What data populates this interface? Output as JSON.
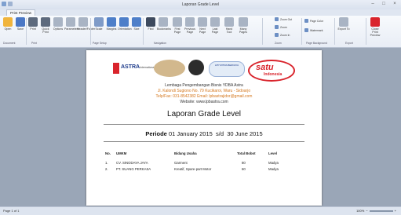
{
  "window": {
    "title": "Laporan Grade Level"
  },
  "tabs": [
    "Print Preview"
  ],
  "ribbon": {
    "buttons": [
      {
        "label": "Open",
        "icon": "open-folder-icon",
        "color": "#f0b43c"
      },
      {
        "label": "Save",
        "icon": "save-disk-icon",
        "color": "#4a77c5"
      },
      {
        "label": "Print",
        "icon": "printer-icon",
        "color": "#5d6a7d"
      },
      {
        "label": "Quick Print",
        "icon": "quick-print-icon",
        "color": "#5d6a7d"
      },
      {
        "label": "Options",
        "icon": "options-icon",
        "color": "#a9b4c4"
      },
      {
        "label": "Parameters",
        "icon": "parameters-icon",
        "color": "#a9b4c4"
      },
      {
        "label": "Header/Footer",
        "icon": "header-footer-icon",
        "color": "#a9b4c4"
      },
      {
        "label": "Scale",
        "icon": "scale-icon",
        "color": "#7f9bc8"
      },
      {
        "label": "Margins",
        "icon": "margins-icon",
        "color": "#4e7fc9"
      },
      {
        "label": "Orientation",
        "icon": "orientation-icon",
        "color": "#4e7fc9"
      },
      {
        "label": "Size",
        "icon": "page-size-icon",
        "color": "#4e7fc9"
      },
      {
        "label": "Find",
        "icon": "find-binoculars-icon",
        "color": "#3d4a5e"
      },
      {
        "label": "Bookmarks",
        "icon": "bookmarks-icon",
        "color": "#a9b4c4"
      },
      {
        "label": "First Page",
        "icon": "first-page-icon",
        "color": "#a9b4c4"
      },
      {
        "label": "Previous Page",
        "icon": "previous-page-icon",
        "color": "#a9b4c4"
      },
      {
        "label": "Next Page",
        "icon": "next-page-icon",
        "color": "#a9b4c4"
      },
      {
        "label": "Last Page",
        "icon": "last-page-icon",
        "color": "#a9b4c4"
      },
      {
        "label": "Hand Tool",
        "icon": "hand-tool-icon",
        "color": "#a9b4c4"
      },
      {
        "label": "Many Pages",
        "icon": "many-pages-icon",
        "color": "#a9b4c4"
      },
      {
        "label": "Export To",
        "icon": "export-icon",
        "color": "#a9b4c4"
      },
      {
        "label": "Close Print Preview",
        "icon": "close-preview-icon",
        "color": "#d9242c"
      }
    ],
    "zoom": {
      "zoom_out": "Zoom Out",
      "zoom": "Zoom",
      "zoom_in": "Zoom In"
    },
    "background": {
      "page_color": "Page Color",
      "watermark": "Watermark"
    },
    "groups": [
      "Document",
      "Print",
      "Page Setup",
      "Navigation",
      "Zoom",
      "Page Background",
      "Export"
    ]
  },
  "report": {
    "header_line1": "Lembaga Pengembangan Bisnis YDBA Astra",
    "header_line2": "Jl. Kalondi Sugiono No. 79 Kucikaroi, Waru - Sidoarjo",
    "header_line3": "Telp/Fax: 031-8542382 Email: lpbastrajidor@gmail.com",
    "header_line4": "Website: www.lpbastra.com",
    "logo_astra": "ASTRA",
    "logo_astra_suffix": "international",
    "logo_lppm": "LPP MITRA BERDAYA",
    "logo_satu": "satu",
    "logo_satu_suffix": "Indonesia",
    "title": "Laporan Grade Level",
    "period_label": "Periode",
    "period_from": "01 January 2015",
    "period_sep": "s/d",
    "period_to": "30 June 2015",
    "columns": [
      "No.",
      "UMKM",
      "Bidang Usaha",
      "Total Bobot",
      "Level"
    ],
    "rows": [
      {
        "no": "1.",
        "umkm": "CV. SINODAYA JAYA",
        "bidang": "Garment",
        "total": "80",
        "level": "Madya"
      },
      {
        "no": "2.",
        "umkm": "PT. SUANG PERKASA",
        "bidang": "Kreatif, Spare-part Motor",
        "total": "60",
        "level": "Madya"
      }
    ]
  },
  "statusbar": {
    "page": "Page 1 of 1",
    "zoom": "100%"
  }
}
